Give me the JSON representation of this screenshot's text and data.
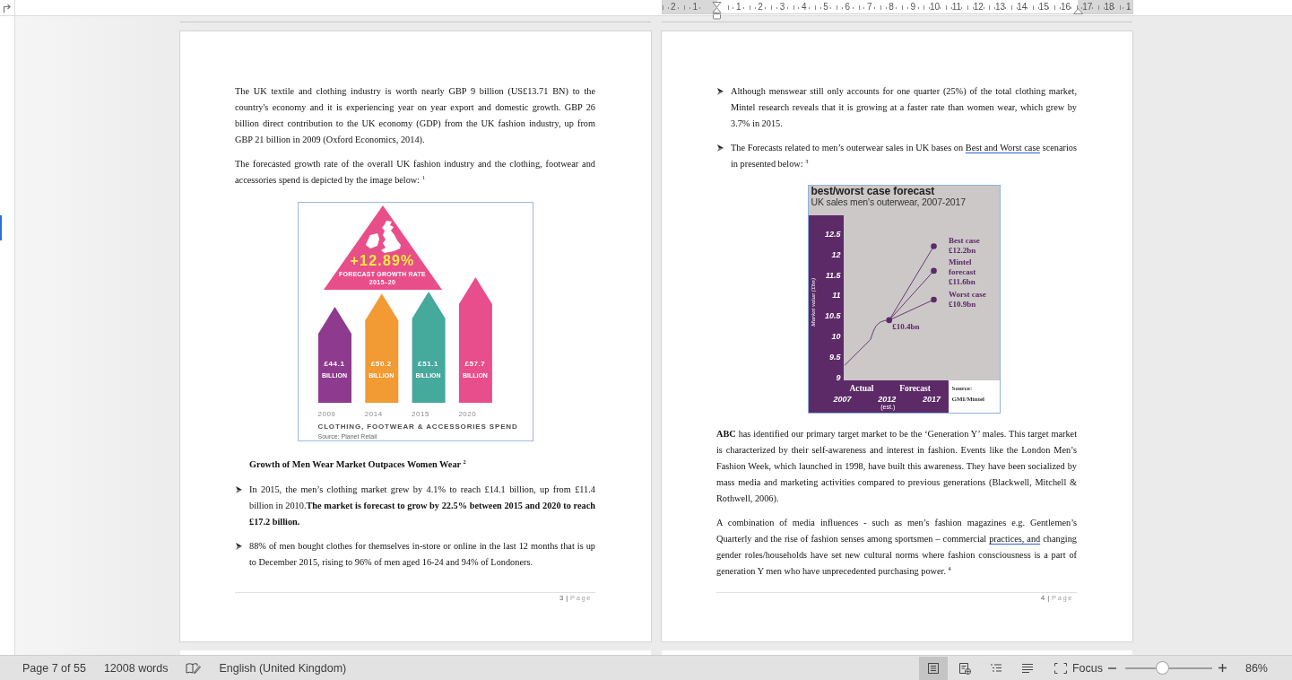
{
  "ruler": {
    "left_labels": [
      "2",
      "1"
    ],
    "right_labels": [
      "1",
      "2",
      "3",
      "4",
      "5",
      "6",
      "7",
      "8",
      "9",
      "10",
      "11",
      "12",
      "13",
      "14",
      "15",
      "16",
      "17",
      "18",
      "1"
    ]
  },
  "pages": [
    {
      "blocks": [
        {
          "kind": "paragraph",
          "runs": [
            {
              "text": "The UK textile and clothing industry is worth nearly GBP 9 billion (US£13.71 BN) to the country's economy and it is experiencing year on year export and domestic growth. GBP 26 billion direct contribution to the UK economy (GDP) from the UK fashion industry, up from GBP 21 billion in 2009 (Oxford Economics, 2014).",
              "flagged": false
            }
          ]
        },
        {
          "kind": "paragraph",
          "runs": [
            {
              "text": "The forecasted growth rate of the overall UK fashion industry and the clothing, footwear and accessories spend is depicted by the image below: $^{1}$",
              "flagged": false
            }
          ]
        },
        {
          "kind": "infographic",
          "badge": {
            "value": "+12.89%",
            "label": "FORECAST GROWTH RATE",
            "period": "2015–20"
          },
          "bars": [
            {
              "unit": "BILLION",
              "color": "#8e3a8e"
            },
            {
              "unit": "BILLION",
              "color": "#f29a33"
            },
            {
              "unit": "BILLION",
              "color": "#45a99c"
            },
            {
              "unit": "BILLION",
              "color": "#e94e8c"
            }
          ],
          "chart_data": {
            "type": "bar",
            "title": "CLOTHING, FOOTWEAR & ACCESSORIES SPEND",
            "categories": [
              "2009",
              "2014",
              "2015",
              "2020"
            ],
            "values": [
              44.1,
              50.2,
              51.1,
              57.7
            ],
            "value_labels": [
              "£44.1",
              "£50.2",
              "£51.1",
              "£57.7"
            ]
          },
          "source": "Source: Planet Retail"
        },
        {
          "kind": "heading",
          "runs": [
            {
              "text": "Growth of Men Wear Market Outpaces Women Wear $^{2}$",
              "flagged": false
            }
          ]
        },
        {
          "kind": "bullet",
          "runs": [
            {
              "text": "In 2015, the men’s clothing market grew by 4.1% to reach £14.1 billion, up from £11.4 billion in 2010.**The market is forecast to grow by 22.5% between 2015 and 2020 to reach £17.2 billion.**",
              "flagged": false
            }
          ]
        },
        {
          "kind": "bullet",
          "runs": [
            {
              "text": "88% of men bought clothes for themselves in-store or online in the last 12 months that is up to December 2015, rising to 96% of men aged 16-24 and 94% of Londoners.",
              "flagged": false
            }
          ]
        }
      ],
      "footer": {
        "number": "3",
        "separator": "|",
        "label": "Page"
      }
    },
    {
      "blocks": [
        {
          "kind": "bullet",
          "runs": [
            {
              "text": "Although menswear still only accounts for one quarter (25%) of the total clothing market, Mintel research reveals that it is growing at a faster rate than women wear, which grew by 3.7% in 2015.",
              "flagged": false
            }
          ]
        },
        {
          "kind": "bullet",
          "runs": [
            {
              "text": "The Forecasts related to men’s outerwear sales in UK bases on ",
              "flagged": false
            },
            {
              "text": "Best and Worst case",
              "flagged": true
            },
            {
              "text": " scenarios in presented below: $^{3}$",
              "flagged": false
            }
          ]
        },
        {
          "kind": "chart",
          "subtitle": "UK sales men's outerwear, 2007-2017",
          "forecast_label": "Forecast",
          "x_note": "(est.)",
          "source_label": "Source:",
          "source": "GMI/Mintel",
          "chart_data": {
            "type": "line",
            "title": "best/worst case forecast",
            "ylabel": "Market value (£bn)",
            "x": [
              2007,
              2012,
              2017
            ],
            "xlim": [
              2007,
              2017
            ],
            "ylim": [
              9,
              12.5
            ],
            "xticks": [
              2007,
              2012,
              2017
            ],
            "yticks": [
              9,
              9.5,
              10,
              10.5,
              11,
              11.5,
              12,
              12.5
            ],
            "series": [
              {
                "name": "Actual",
                "color": "#5b2a67",
                "values": [
                  9.3,
                  10.4,
                  null
                ]
              },
              {
                "name": "Best case",
                "color": "#5b2a67",
                "values": [
                  null,
                  10.4,
                  12.2
                ]
              },
              {
                "name": "Mintel forecast",
                "color": "#5b2a67",
                "values": [
                  null,
                  10.4,
                  11.6
                ]
              },
              {
                "name": "Worst case",
                "color": "#5b2a67",
                "values": [
                  null,
                  10.4,
                  10.9
                ]
              }
            ],
            "annotations": [
              "£12.2bn",
              "£11.6bn",
              "£10.9bn",
              "£10.4bn"
            ]
          }
        },
        {
          "kind": "paragraph",
          "runs": [
            {
              "text": "**ABC** has identified our primary target market to be the ‘Generation Y’ males. This target market is characterized by their self-awareness and interest in fashion. Events like the London Men’s Fashion Week, which launched in 1998, have built this awareness. They have been socialized by mass media and marketing activities compared to previous generations (Blackwell, Mitchell & Rothwell, 2006).",
              "flagged": false
            }
          ]
        },
        {
          "kind": "paragraph",
          "runs": [
            {
              "text": "A combination of media influences - such as men’s fashion magazines e.g. Gentlemen’s Quarterly and the rise of fashion senses among sportsmen – commercial ",
              "flagged": false
            },
            {
              "text": "practices, and",
              "flagged": true
            },
            {
              "text": " changing gender roles/households have set new cultural norms where fashion consciousness is a part of generation Y men who have unprecedented purchasing power. $^{4}$",
              "flagged": false
            }
          ]
        }
      ],
      "footer": {
        "number": "4",
        "separator": "|",
        "label": "Page"
      }
    }
  ],
  "status_bar": {
    "page": "Page 7 of 55",
    "words": "12008 words",
    "language": "English (United Kingdom)",
    "views": [
      {
        "kind": "print",
        "selected": true
      },
      {
        "kind": "web",
        "selected": false
      },
      {
        "kind": "outline",
        "selected": false
      },
      {
        "kind": "draft",
        "selected": false
      }
    ],
    "focus": "Focus",
    "zoom": {
      "level": 0.42,
      "value": "86%"
    }
  }
}
